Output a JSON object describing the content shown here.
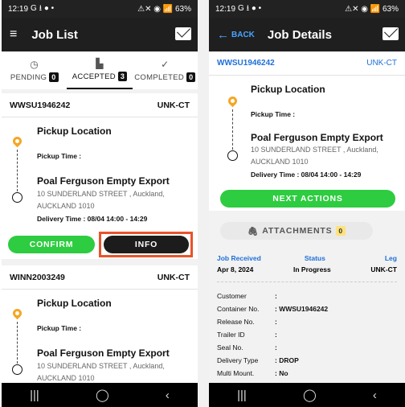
{
  "status_bar": {
    "time": "12:19",
    "left_icons": "G ⭳ ● •",
    "right_icons": "⚠✕ ◉ 📶 63%"
  },
  "left_screen": {
    "title": "Job List",
    "tabs": [
      {
        "label": "PENDING",
        "count": "0"
      },
      {
        "label": "ACCEPTED",
        "count": "3"
      },
      {
        "label": "COMPLETED",
        "count": "0"
      }
    ],
    "jobs": [
      {
        "id": "WWSU1946242",
        "code": "UNK-CT",
        "pickup_title": "Pickup Location",
        "pickup_time": "Pickup Time :",
        "dest_title": "Poal Ferguson Empty Export",
        "address1": "10 SUNDERLAND STREET , Auckland,",
        "address2": "AUCKLAND 1010",
        "delivery_time": "Delivery Time : 08/04 14:00 - 14:29",
        "confirm_label": "CONFIRM",
        "info_label": "INFO"
      },
      {
        "id": "WINN2003249",
        "code": "UNK-CT",
        "pickup_title": "Pickup Location",
        "pickup_time": "Pickup Time :",
        "dest_title": "Poal Ferguson Empty Export",
        "address1": "10 SUNDERLAND STREET , Auckland,",
        "address2": "AUCKLAND 1010"
      }
    ]
  },
  "right_screen": {
    "back_label": "BACK",
    "title": "Job Details",
    "job_id": "WWSU1946242",
    "code": "UNK-CT",
    "pickup_title": "Pickup Location",
    "pickup_time": "Pickup Time :",
    "dest_title": "Poal Ferguson Empty Export",
    "address1": "10 SUNDERLAND STREET , Auckland,",
    "address2": "AUCKLAND 1010",
    "delivery_time": "Delivery Time : 08/04 14:00 - 14:29",
    "next_actions_label": "NEXT ACTIONS",
    "attachments_label": "ATTACHMENTS",
    "attachments_count": "0",
    "summary": {
      "received_label": "Job Received",
      "received_value": "Apr 8, 2024",
      "status_label": "Status",
      "status_value": "In Progress",
      "leg_label": "Leg",
      "leg_value": "UNK-CT"
    },
    "details": [
      {
        "k": "Customer",
        "v": ":"
      },
      {
        "k": "Container No.",
        "v": ": WWSU1946242"
      },
      {
        "k": "Release No.",
        "v": ":"
      },
      {
        "k": "Trailer ID",
        "v": ":"
      },
      {
        "k": "Seal No.",
        "v": ":"
      },
      {
        "k": "Delivery Type",
        "v": ": DROP"
      },
      {
        "k": "Multi Mount.",
        "v": ": No"
      }
    ]
  },
  "nav": {
    "recent": "|||",
    "home": "◯",
    "back": "‹"
  },
  "colors": {
    "accent_green": "#2ecc40",
    "highlight": "#e8542a",
    "link_blue": "#1e6fd9",
    "pin": "#f5a623"
  }
}
